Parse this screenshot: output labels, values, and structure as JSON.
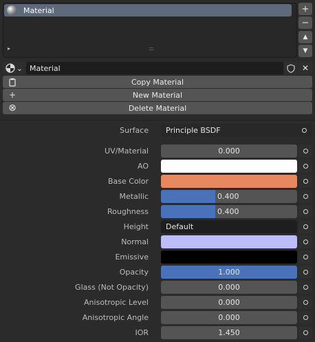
{
  "slot_list": {
    "items": [
      {
        "label": "Material",
        "selected": true
      }
    ],
    "add_label": "+",
    "remove_label": "−",
    "up_label": "▲",
    "down_label": "▼",
    "expand_label": "▸",
    "grip_label": "::::"
  },
  "datablock": {
    "type_icon": "material-sphere-icon",
    "dropdown_glyph": "⌄",
    "name": "Material",
    "fake_user_icon": "shield-icon",
    "unlink_label": "✕"
  },
  "operators": {
    "copy": "Copy Material",
    "new": "New Material",
    "delete": "Delete Material",
    "new_glyph": "+",
    "delete_glyph": "⊗"
  },
  "properties": {
    "surface": {
      "label": "Surface",
      "value": "Principle BSDF"
    },
    "uv_material": {
      "label": "UV/Material",
      "value": "0.000"
    },
    "ao": {
      "label": "AO",
      "color": "#ffffff"
    },
    "base_color": {
      "label": "Base Color",
      "color": "#e88860"
    },
    "metallic": {
      "label": "Metallic",
      "value": "0.400",
      "fraction": 0.4
    },
    "roughness": {
      "label": "Roughness",
      "value": "0.400",
      "fraction": 0.4
    },
    "height": {
      "label": "Height",
      "value": "Default"
    },
    "normal": {
      "label": "Normal",
      "color": "#bdbdfb"
    },
    "emissive": {
      "label": "Emissive",
      "color": "#000000"
    },
    "opacity": {
      "label": "Opacity",
      "value": "1.000",
      "fraction": 1.0
    },
    "glass": {
      "label": "Glass (Not Opacity)",
      "value": "0.000"
    },
    "aniso_level": {
      "label": "Anisotropic Level",
      "value": "0.000"
    },
    "aniso_angle": {
      "label": "Anisotropic Angle",
      "value": "0.000"
    },
    "ior": {
      "label": "IOR",
      "value": "1.450"
    }
  },
  "colors": {
    "accent": "#4a72b8",
    "panel_bg": "#2b2b2b",
    "field_bg": "#545454",
    "selected_slot": "#5e6a7a"
  }
}
